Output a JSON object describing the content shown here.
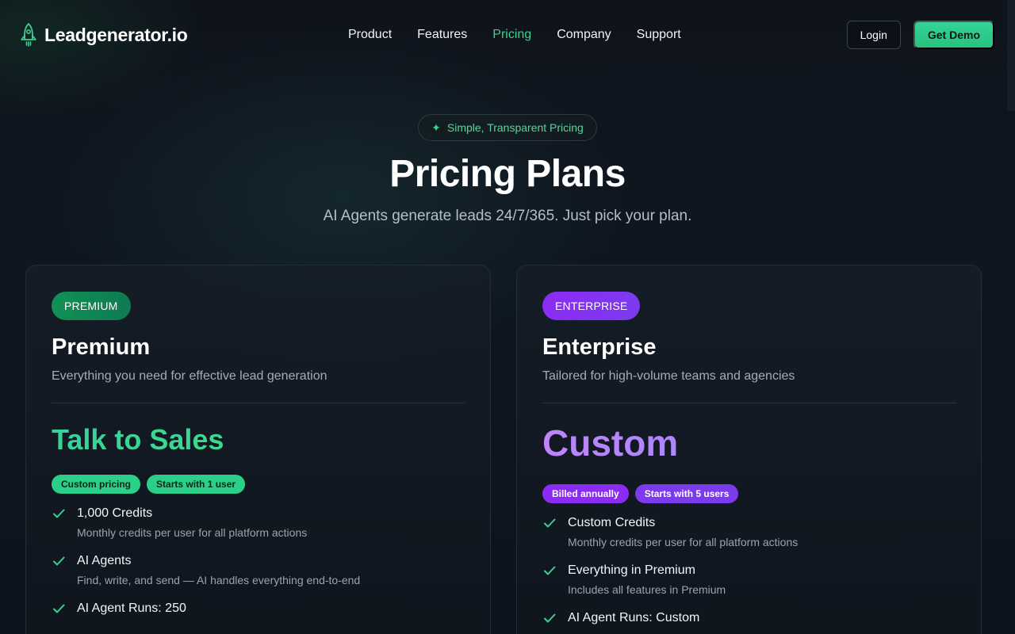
{
  "header": {
    "brand_name": "Leadgenerator.io",
    "nav": [
      {
        "label": "Product",
        "active": false
      },
      {
        "label": "Features",
        "active": false
      },
      {
        "label": "Pricing",
        "active": true
      },
      {
        "label": "Company",
        "active": false
      },
      {
        "label": "Support",
        "active": false
      }
    ],
    "login_label": "Login",
    "demo_label": "Get Demo"
  },
  "hero": {
    "pill_label": "Simple, Transparent Pricing",
    "title": "Pricing Plans",
    "subtitle": "AI Agents generate leads 24/7/365. Just pick your plan."
  },
  "plans": {
    "premium": {
      "badge": "PREMIUM",
      "name": "Premium",
      "description": "Everything you need for effective lead generation",
      "price": "Talk to Sales",
      "chips": [
        "Custom pricing",
        "Starts with 1 user"
      ],
      "features": [
        {
          "title": "1,000 Credits",
          "sub": "Monthly credits per user for all platform actions"
        },
        {
          "title": "AI Agents",
          "sub": "Find, write, and send — AI handles everything end-to-end"
        },
        {
          "title": "AI Agent Runs: 250",
          "sub": ""
        }
      ]
    },
    "enterprise": {
      "badge": "ENTERPRISE",
      "name": "Enterprise",
      "description": "Tailored for high-volume teams and agencies",
      "price": "Custom",
      "chips": [
        "Billed annually",
        "Starts with 5 users"
      ],
      "features": [
        {
          "title": "Custom Credits",
          "sub": "Monthly credits per user for all platform actions"
        },
        {
          "title": "Everything in Premium",
          "sub": "Includes all features in Premium"
        },
        {
          "title": "AI Agent Runs: Custom",
          "sub": ""
        }
      ]
    }
  },
  "colors": {
    "accent_green": "#3ecf8e",
    "accent_purple": "#8b2cf5",
    "background": "#0d131c"
  },
  "icons": {
    "logo": "rocket-icon",
    "pill": "sparkle-icon",
    "feature": "check-icon"
  }
}
